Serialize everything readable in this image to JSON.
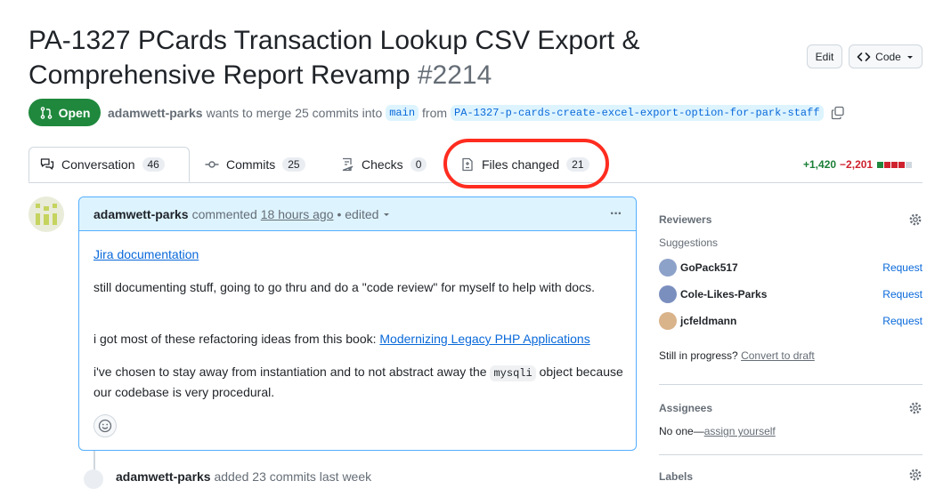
{
  "pr": {
    "title": "PA-1327 PCards Transaction Lookup CSV Export & Comprehensive Report Revamp",
    "number": "#2214",
    "state": "Open",
    "author": "adamwett-parks",
    "merge_text": "wants to merge 25 commits into",
    "base_branch": "main",
    "from_text": "from",
    "head_branch": "PA-1327-p-cards-create-excel-export-option-for-park-staff"
  },
  "header_buttons": {
    "edit": "Edit",
    "code": "Code"
  },
  "tabs": [
    {
      "label": "Conversation",
      "count": "46"
    },
    {
      "label": "Commits",
      "count": "25"
    },
    {
      "label": "Checks",
      "count": "0"
    },
    {
      "label": "Files changed",
      "count": "21"
    }
  ],
  "diffstat": {
    "additions": "+1,420",
    "deletions": "−2,201"
  },
  "comment": {
    "author": "adamwett-parks",
    "action": "commented",
    "time": "18 hours ago",
    "edited": "• edited",
    "menu": "···",
    "link1": "Jira documentation",
    "p1": "still documenting stuff, going to go thru and do a \"code review\" for myself to help with docs.",
    "p2_prefix": "i got most of these refactoring ideas from this book:",
    "p2_link": "Modernizing Legacy PHP Applications",
    "p3_prefix": "i've chosen to stay away from instantiation and to not abstract away the",
    "p3_code": "mysqli",
    "p3_suffix": "object because our codebase is very procedural."
  },
  "timeline": {
    "author": "adamwett-parks",
    "text": "added 23 commits last week"
  },
  "sidebar": {
    "reviewers_title": "Reviewers",
    "suggestions": "Suggestions",
    "reviewers": [
      {
        "name": "GoPack517",
        "action": "Request",
        "color": "#8da2c9"
      },
      {
        "name": "Cole-Likes-Parks",
        "action": "Request",
        "color": "#7b8fbf"
      },
      {
        "name": "jcfeldmann",
        "action": "Request",
        "color": "#d9b38a"
      }
    ],
    "progress_prefix": "Still in progress?",
    "progress_link": "Convert to draft",
    "assignees_title": "Assignees",
    "assignees_none": "No one—",
    "assign_link": "assign yourself",
    "labels_title": "Labels"
  },
  "colors": {
    "open_green": "#1f883d",
    "link_blue": "#0969da",
    "highlight": "#ff2c1f"
  }
}
